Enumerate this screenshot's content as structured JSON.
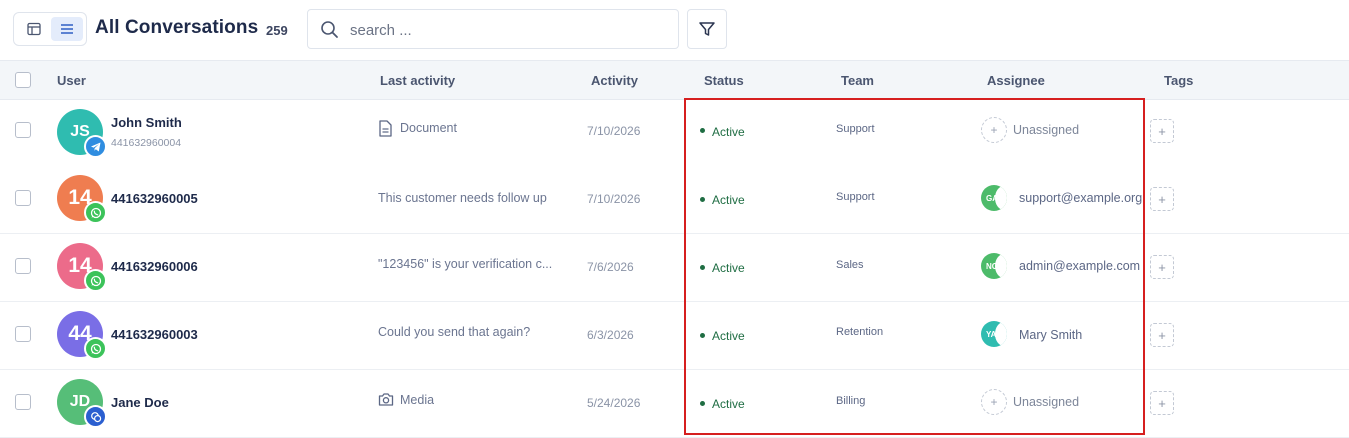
{
  "header": {
    "title": "All Conversations",
    "count": "259",
    "search_placeholder": "search ..."
  },
  "columns": {
    "user": "User",
    "last_activity": "Last activity",
    "activity": "Activity",
    "status": "Status",
    "team": "Team",
    "assignee": "Assignee",
    "tags": "Tags"
  },
  "rows": [
    {
      "avatar_text": "JS",
      "avatar_color": "#2fbcb0",
      "channel": "telegram",
      "channel_color": "#2f8de0",
      "name": "John Smith",
      "phone": "441632960004",
      "last_activity_icon": "document-icon",
      "last_activity": "Document",
      "date": "7/10/2026",
      "status": "Active",
      "team": "Support",
      "assignee": "Unassigned",
      "assignee_initials": "",
      "assignee_color": ""
    },
    {
      "avatar_text": "14",
      "avatar_color": "#ef7d50",
      "channel": "whatsapp",
      "channel_color": "#3cc35a",
      "name": "441632960005",
      "phone": "",
      "last_activity_icon": "",
      "last_activity": "This customer needs follow up",
      "date": "7/10/2026",
      "status": "Active",
      "team": "Support",
      "assignee": "support@example.org",
      "assignee_initials": "GA",
      "assignee_color": "#4dbb6a"
    },
    {
      "avatar_text": "14",
      "avatar_color": "#ec6b8a",
      "channel": "whatsapp",
      "channel_color": "#3cc35a",
      "name": "441632960006",
      "phone": "",
      "last_activity_icon": "",
      "last_activity": "\"123456\" is your verification c...",
      "date": "7/6/2026",
      "status": "Active",
      "team": "Sales",
      "assignee": "admin@example.com",
      "assignee_initials": "NC",
      "assignee_color": "#4dbb6a"
    },
    {
      "avatar_text": "44",
      "avatar_color": "#7a6ee6",
      "channel": "whatsapp",
      "channel_color": "#3cc35a",
      "name": "441632960003",
      "phone": "",
      "last_activity_icon": "",
      "last_activity": "Could you send that again?",
      "date": "6/3/2026",
      "status": "Active",
      "team": "Retention",
      "assignee": "Mary Smith",
      "assignee_initials": "YA",
      "assignee_color": "#2fbcb0"
    },
    {
      "avatar_text": "JD",
      "avatar_color": "#56be78",
      "channel": "messenger",
      "channel_color": "#2b5fd0",
      "name": "Jane Doe",
      "phone": "",
      "last_activity_icon": "camera-icon",
      "last_activity": "Media",
      "date": "5/24/2026",
      "status": "Active",
      "team": "Billing",
      "assignee": "Unassigned",
      "assignee_initials": "",
      "assignee_color": ""
    }
  ],
  "tags_add": "+",
  "assign_add": "+"
}
